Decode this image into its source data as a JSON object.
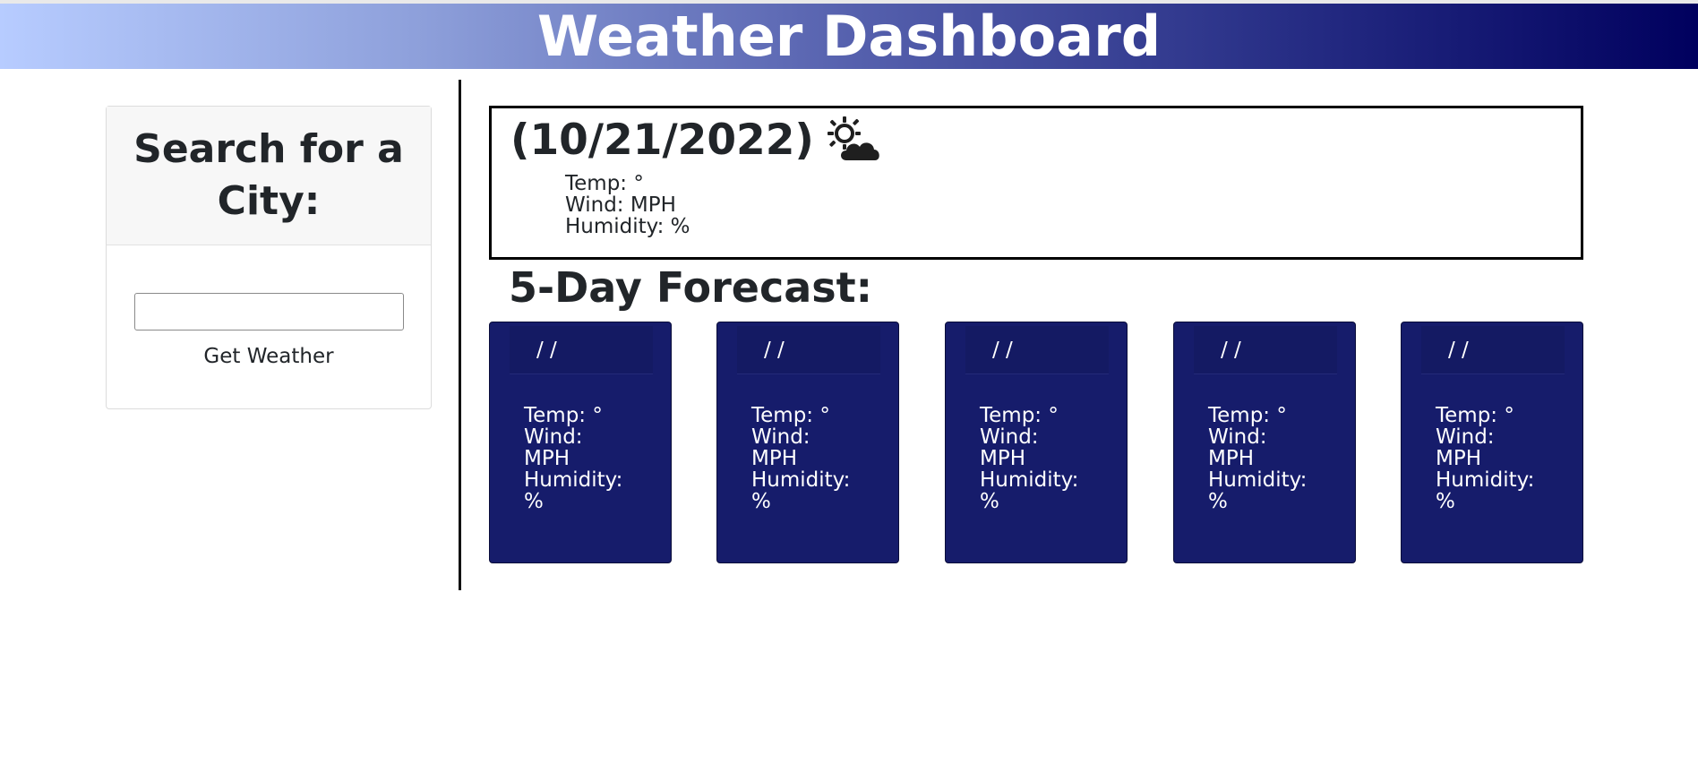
{
  "header": {
    "title": "Weather Dashboard"
  },
  "search": {
    "title": "Search for a City:",
    "input_value": "",
    "input_placeholder": "",
    "button_label": "Get Weather"
  },
  "current": {
    "date": "(10/21/2022)",
    "icon": "sun-behind-cloud-icon",
    "temp": "Temp: °",
    "wind": "Wind: MPH",
    "humidity": "Humidity: %"
  },
  "forecast": {
    "title": "5-Day Forecast:",
    "cards": [
      {
        "date": "/ /",
        "temp": "Temp: °",
        "wind_label": "Wind:",
        "wind_unit": "MPH",
        "humidity_label": "Humidity:",
        "humidity_unit": "%"
      },
      {
        "date": "/ /",
        "temp": "Temp: °",
        "wind_label": "Wind:",
        "wind_unit": "MPH",
        "humidity_label": "Humidity:",
        "humidity_unit": "%"
      },
      {
        "date": "/ /",
        "temp": "Temp: °",
        "wind_label": "Wind:",
        "wind_unit": "MPH",
        "humidity_label": "Humidity:",
        "humidity_unit": "%"
      },
      {
        "date": "/ /",
        "temp": "Temp: °",
        "wind_label": "Wind:",
        "wind_unit": "MPH",
        "humidity_label": "Humidity:",
        "humidity_unit": "%"
      },
      {
        "date": "/ /",
        "temp": "Temp: °",
        "wind_label": "Wind:",
        "wind_unit": "MPH",
        "humidity_label": "Humidity:",
        "humidity_unit": "%"
      }
    ]
  },
  "colors": {
    "header_gradient_start": "#b7ccff",
    "header_gradient_end": "#00005e",
    "forecast_card_bg": "#161c6b"
  }
}
